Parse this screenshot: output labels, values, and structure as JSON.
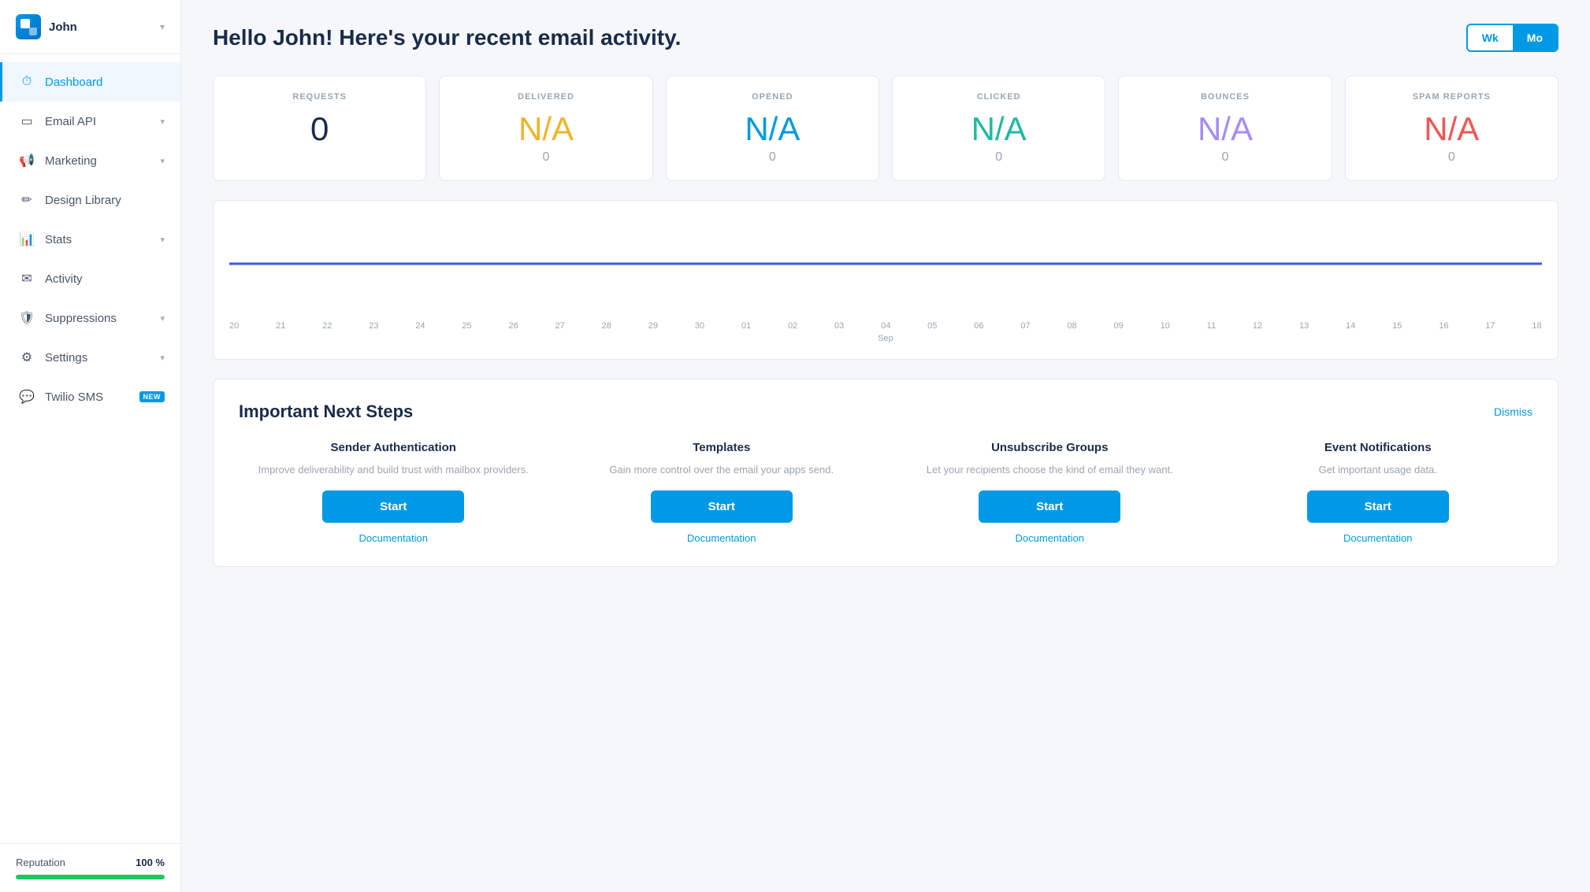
{
  "sidebar": {
    "logo_text": "John",
    "nav_items": [
      {
        "id": "dashboard",
        "label": "Dashboard",
        "icon": "⏱",
        "has_chevron": false,
        "active": true
      },
      {
        "id": "email-api",
        "label": "Email API",
        "icon": "▭",
        "has_chevron": true
      },
      {
        "id": "marketing",
        "label": "Marketing",
        "icon": "📢",
        "has_chevron": true
      },
      {
        "id": "design-library",
        "label": "Design Library",
        "icon": "✏",
        "has_chevron": false
      },
      {
        "id": "stats",
        "label": "Stats",
        "icon": "📊",
        "has_chevron": true
      },
      {
        "id": "activity",
        "label": "Activity",
        "icon": "✉",
        "has_chevron": false
      },
      {
        "id": "suppressions",
        "label": "Suppressions",
        "icon": "🛡",
        "has_chevron": true
      },
      {
        "id": "settings",
        "label": "Settings",
        "icon": "⚙",
        "has_chevron": true
      },
      {
        "id": "twilio-sms",
        "label": "Twilio SMS",
        "icon": "💬",
        "badge": "NEW",
        "has_chevron": false
      }
    ],
    "reputation_label": "Reputation",
    "reputation_pct": "100 %",
    "reputation_value": 100
  },
  "header": {
    "title": "Hello John! Here's your recent email activity.",
    "time_toggle": {
      "wk_label": "Wk",
      "mo_label": "Mo",
      "active": "Mo"
    }
  },
  "stats": [
    {
      "id": "requests",
      "label": "REQUESTS",
      "value": "0",
      "sub": "",
      "class": "requests"
    },
    {
      "id": "delivered",
      "label": "DELIVERED",
      "value": "N/A",
      "sub": "0",
      "class": "delivered"
    },
    {
      "id": "opened",
      "label": "OPENED",
      "value": "N/A",
      "sub": "0",
      "class": "opened"
    },
    {
      "id": "clicked",
      "label": "CLICKED",
      "value": "N/A",
      "sub": "0",
      "class": "clicked"
    },
    {
      "id": "bounces",
      "label": "BOUNCES",
      "value": "N/A",
      "sub": "0",
      "class": "bounces"
    },
    {
      "id": "spam-reports",
      "label": "SPAM REPORTS",
      "value": "N/A",
      "sub": "0",
      "class": "spam"
    }
  ],
  "chart": {
    "x_labels": [
      "20",
      "21",
      "22",
      "23",
      "24",
      "25",
      "26",
      "27",
      "28",
      "29",
      "30",
      "01",
      "02",
      "03",
      "04",
      "05",
      "06",
      "07",
      "08",
      "09",
      "10",
      "11",
      "12",
      "13",
      "14",
      "15",
      "16",
      "17",
      "18"
    ],
    "sep_label": "Sep"
  },
  "next_steps": {
    "title": "Important Next Steps",
    "dismiss_label": "Dismiss",
    "steps": [
      {
        "id": "sender-auth",
        "title": "Sender Authentication",
        "desc": "Improve deliverability and build trust with mailbox providers.",
        "start_label": "Start",
        "doc_label": "Documentation"
      },
      {
        "id": "templates",
        "title": "Templates",
        "desc": "Gain more control over the email your apps send.",
        "start_label": "Start",
        "doc_label": "Documentation"
      },
      {
        "id": "unsubscribe-groups",
        "title": "Unsubscribe Groups",
        "desc": "Let your recipients choose the kind of email they want.",
        "start_label": "Start",
        "doc_label": "Documentation"
      },
      {
        "id": "event-notifications",
        "title": "Event Notifications",
        "desc": "Get important usage data.",
        "start_label": "Start",
        "doc_label": "Documentation"
      }
    ]
  }
}
